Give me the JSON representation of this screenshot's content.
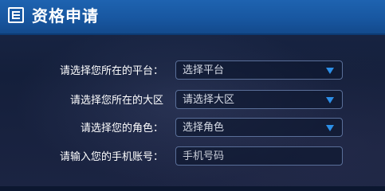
{
  "header": {
    "title": "资格申请",
    "icon": "form-icon"
  },
  "form": {
    "platform": {
      "label": "请选择您所在的平台：",
      "value": "选择平台"
    },
    "region": {
      "label": "请选择您所在的大区",
      "value": "请选择大区"
    },
    "role": {
      "label": "请选择您的角色：",
      "value": "选择角色"
    },
    "phone": {
      "label": "请输入您的手机账号：",
      "placeholder": "手机号码"
    }
  },
  "colors": {
    "header_bg": "#1a5ca8",
    "body_bg": "#16213f",
    "accent": "#2c8fe8",
    "text": "#ffffff"
  }
}
